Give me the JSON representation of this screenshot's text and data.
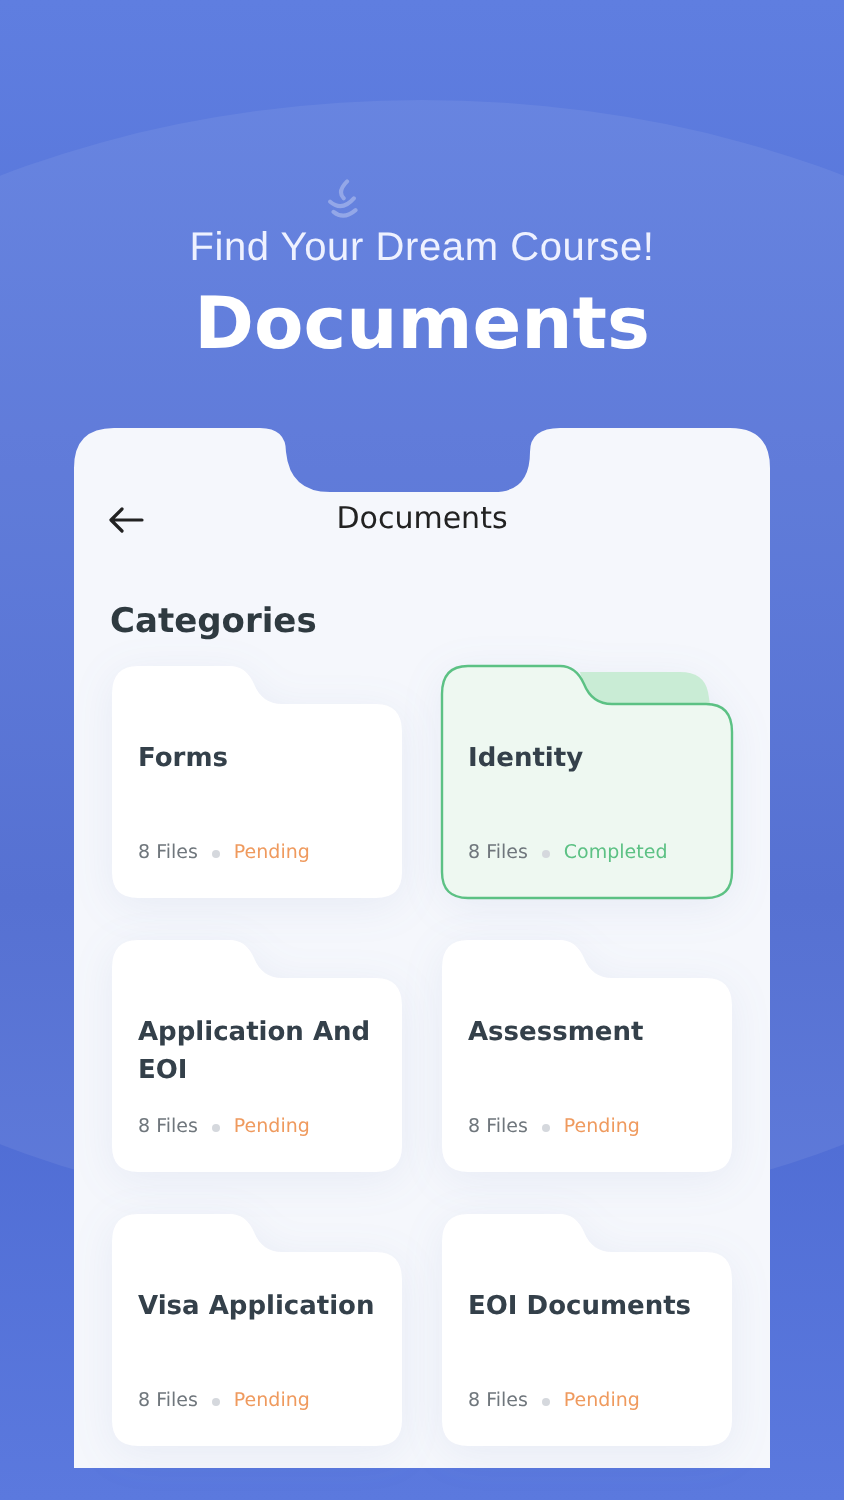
{
  "header": {
    "tagline": "Find Your Dream Course!",
    "title": "Documents"
  },
  "screen": {
    "title": "Documents",
    "section": "Categories",
    "categories": [
      {
        "name": "Forms",
        "files": "8 Files",
        "status": "Pending",
        "kind": "pending"
      },
      {
        "name": "Identity",
        "files": "8 Files",
        "status": "Completed",
        "kind": "completed"
      },
      {
        "name": "Application And EOI",
        "files": "8 Files",
        "status": "Pending",
        "kind": "pending"
      },
      {
        "name": "Assessment",
        "files": "8 Files",
        "status": "Pending",
        "kind": "pending"
      },
      {
        "name": "Visa Application",
        "files": "8 Files",
        "status": "Pending",
        "kind": "pending"
      },
      {
        "name": "EOI Documents",
        "files": "8 Files",
        "status": "Pending",
        "kind": "pending"
      }
    ]
  }
}
